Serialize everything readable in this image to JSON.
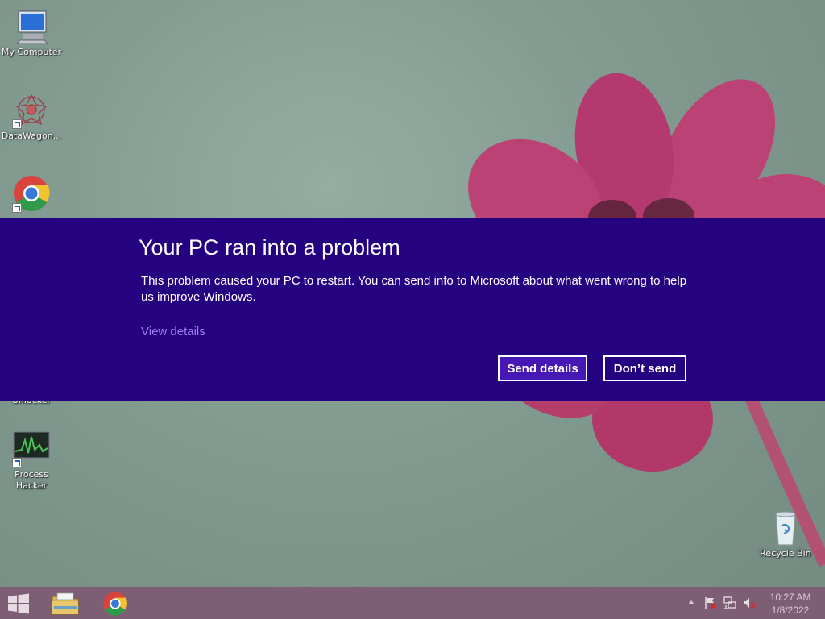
{
  "desktop": {
    "icons": [
      {
        "label": "My Computer"
      },
      {
        "label": "DataWagon..."
      },
      {
        "label": "Unlocker"
      },
      {
        "label": "Process Hacker"
      },
      {
        "label": "Recycle Bin"
      }
    ]
  },
  "dialog": {
    "title": "Your PC ran into a problem",
    "message": "This problem caused your PC to restart. You can send info to Microsoft about what went wrong to help us improve Windows.",
    "details_link": "View details",
    "send_button": "Send details",
    "dont_send_button": "Don’t send"
  },
  "taskbar": {
    "apps": [
      {
        "icon": "file-explorer-icon"
      },
      {
        "icon": "chrome-icon"
      }
    ],
    "tray": {
      "icons": [
        "show-hidden-icons-icon",
        "action-center-flag-icon",
        "network-icon",
        "volume-muted-icon"
      ]
    },
    "clock": {
      "time": "10:27 AM",
      "date": "1/8/2022"
    }
  },
  "colors": {
    "banner": "#250380",
    "send_button": "#4617b4",
    "link": "#9f7cf0",
    "taskbar": "#7e5e74"
  }
}
